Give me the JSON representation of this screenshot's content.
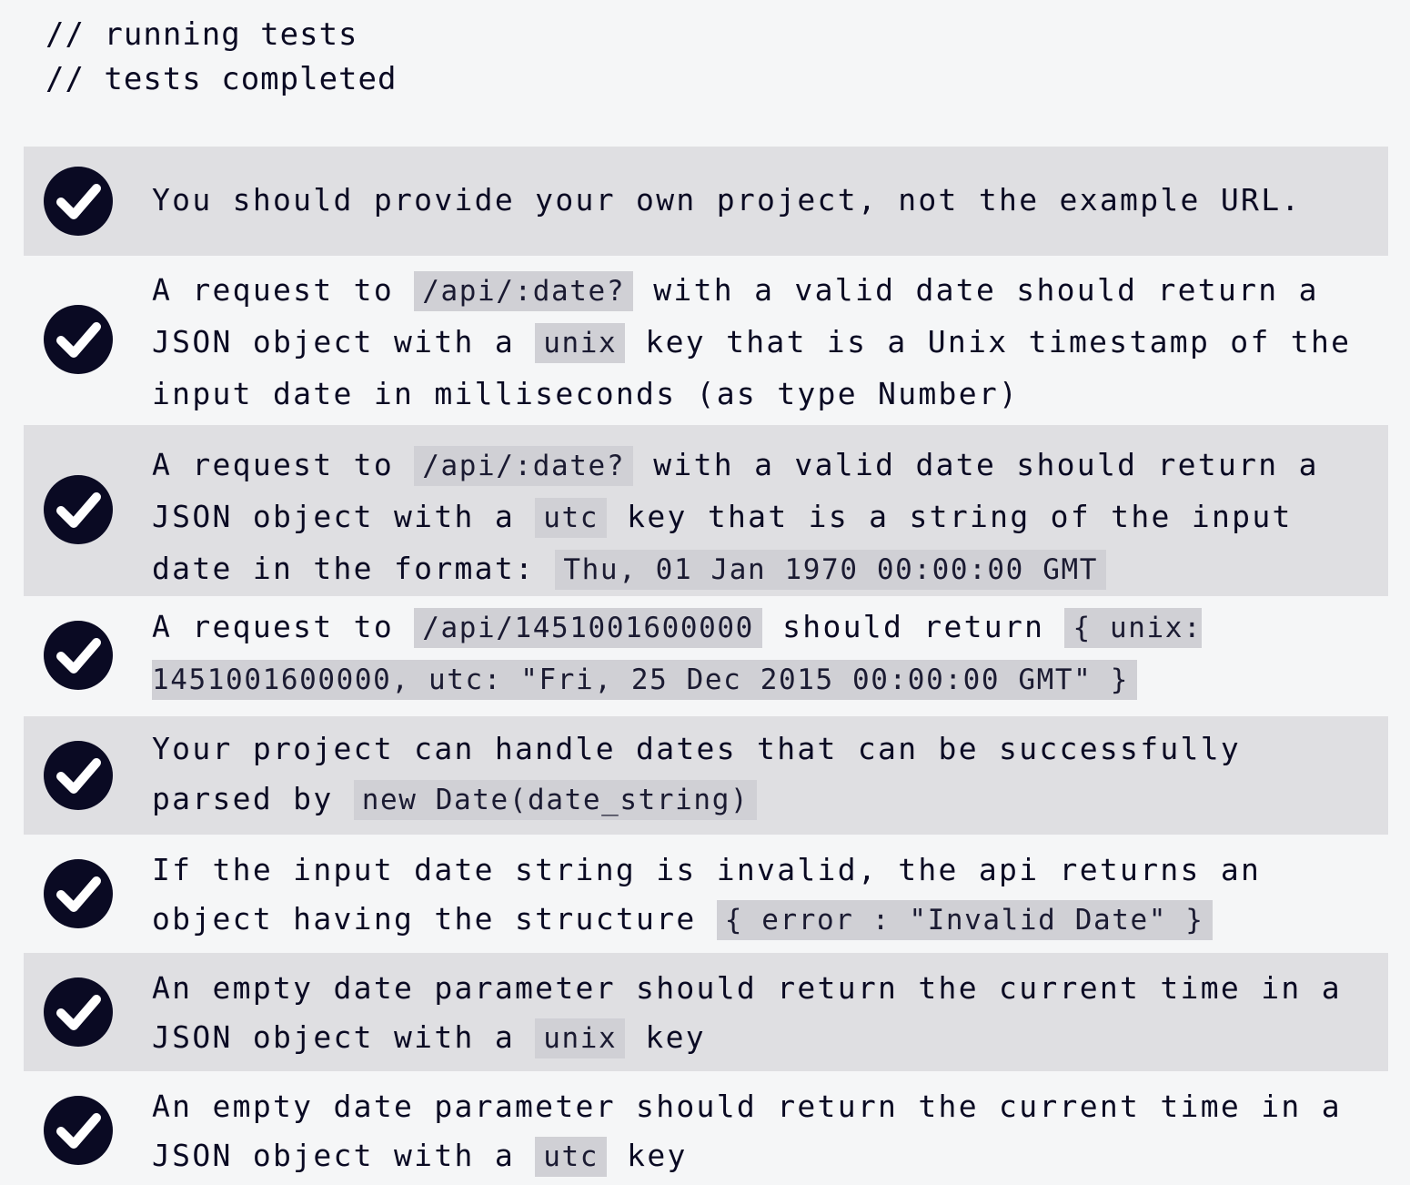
{
  "console": {
    "lines": [
      "// running tests",
      "// tests completed"
    ]
  },
  "tests": [
    {
      "status": "passed",
      "segments": [
        {
          "text": "You should provide your own project, not the example URL."
        }
      ]
    },
    {
      "status": "passed",
      "segments": [
        {
          "text": "A request to "
        },
        {
          "code": "/api/:date?"
        },
        {
          "text": " with a valid date should return a JSON object with a "
        },
        {
          "code": "unix"
        },
        {
          "text": " key that is a Unix timestamp of the input date in milliseconds (as type Number)"
        }
      ]
    },
    {
      "status": "passed",
      "segments": [
        {
          "text": "A request to "
        },
        {
          "code": "/api/:date?"
        },
        {
          "text": " with a valid date should return a JSON object with a "
        },
        {
          "code": "utc"
        },
        {
          "text": " key that is a string of the input date in the format: "
        },
        {
          "code": "Thu, 01 Jan 1970 00:00:00 GMT"
        }
      ]
    },
    {
      "status": "passed",
      "segments": [
        {
          "text": "A request to "
        },
        {
          "code": "/api/1451001600000"
        },
        {
          "text": " should return "
        },
        {
          "code": "{ unix: 1451001600000, utc: \"Fri, 25 Dec 2015 00:00:00 GMT\" }"
        }
      ]
    },
    {
      "status": "passed",
      "segments": [
        {
          "text": "Your project can handle dates that can be successfully parsed by "
        },
        {
          "code": "new Date(date_string)"
        }
      ]
    },
    {
      "status": "passed",
      "segments": [
        {
          "text": "If the input date string is invalid, the api returns an object having the structure "
        },
        {
          "code": "{ error : \"Invalid Date\" }"
        }
      ]
    },
    {
      "status": "passed",
      "segments": [
        {
          "text": "An empty date parameter should return the current time in a JSON object with a "
        },
        {
          "code": "unix"
        },
        {
          "text": " key"
        }
      ]
    },
    {
      "status": "passed",
      "segments": [
        {
          "text": "An empty date parameter should return the current time in a JSON object with a "
        },
        {
          "code": "utc"
        },
        {
          "text": " key"
        }
      ]
    }
  ],
  "colors": {
    "background": "#f5f6f7",
    "row_shade": "#dfdfe2",
    "code_bg": "#d0d0d5",
    "check_fill": "#0a0a23",
    "check_mark": "#ffffff"
  },
  "icons": {
    "passed": "check-circle-icon"
  }
}
